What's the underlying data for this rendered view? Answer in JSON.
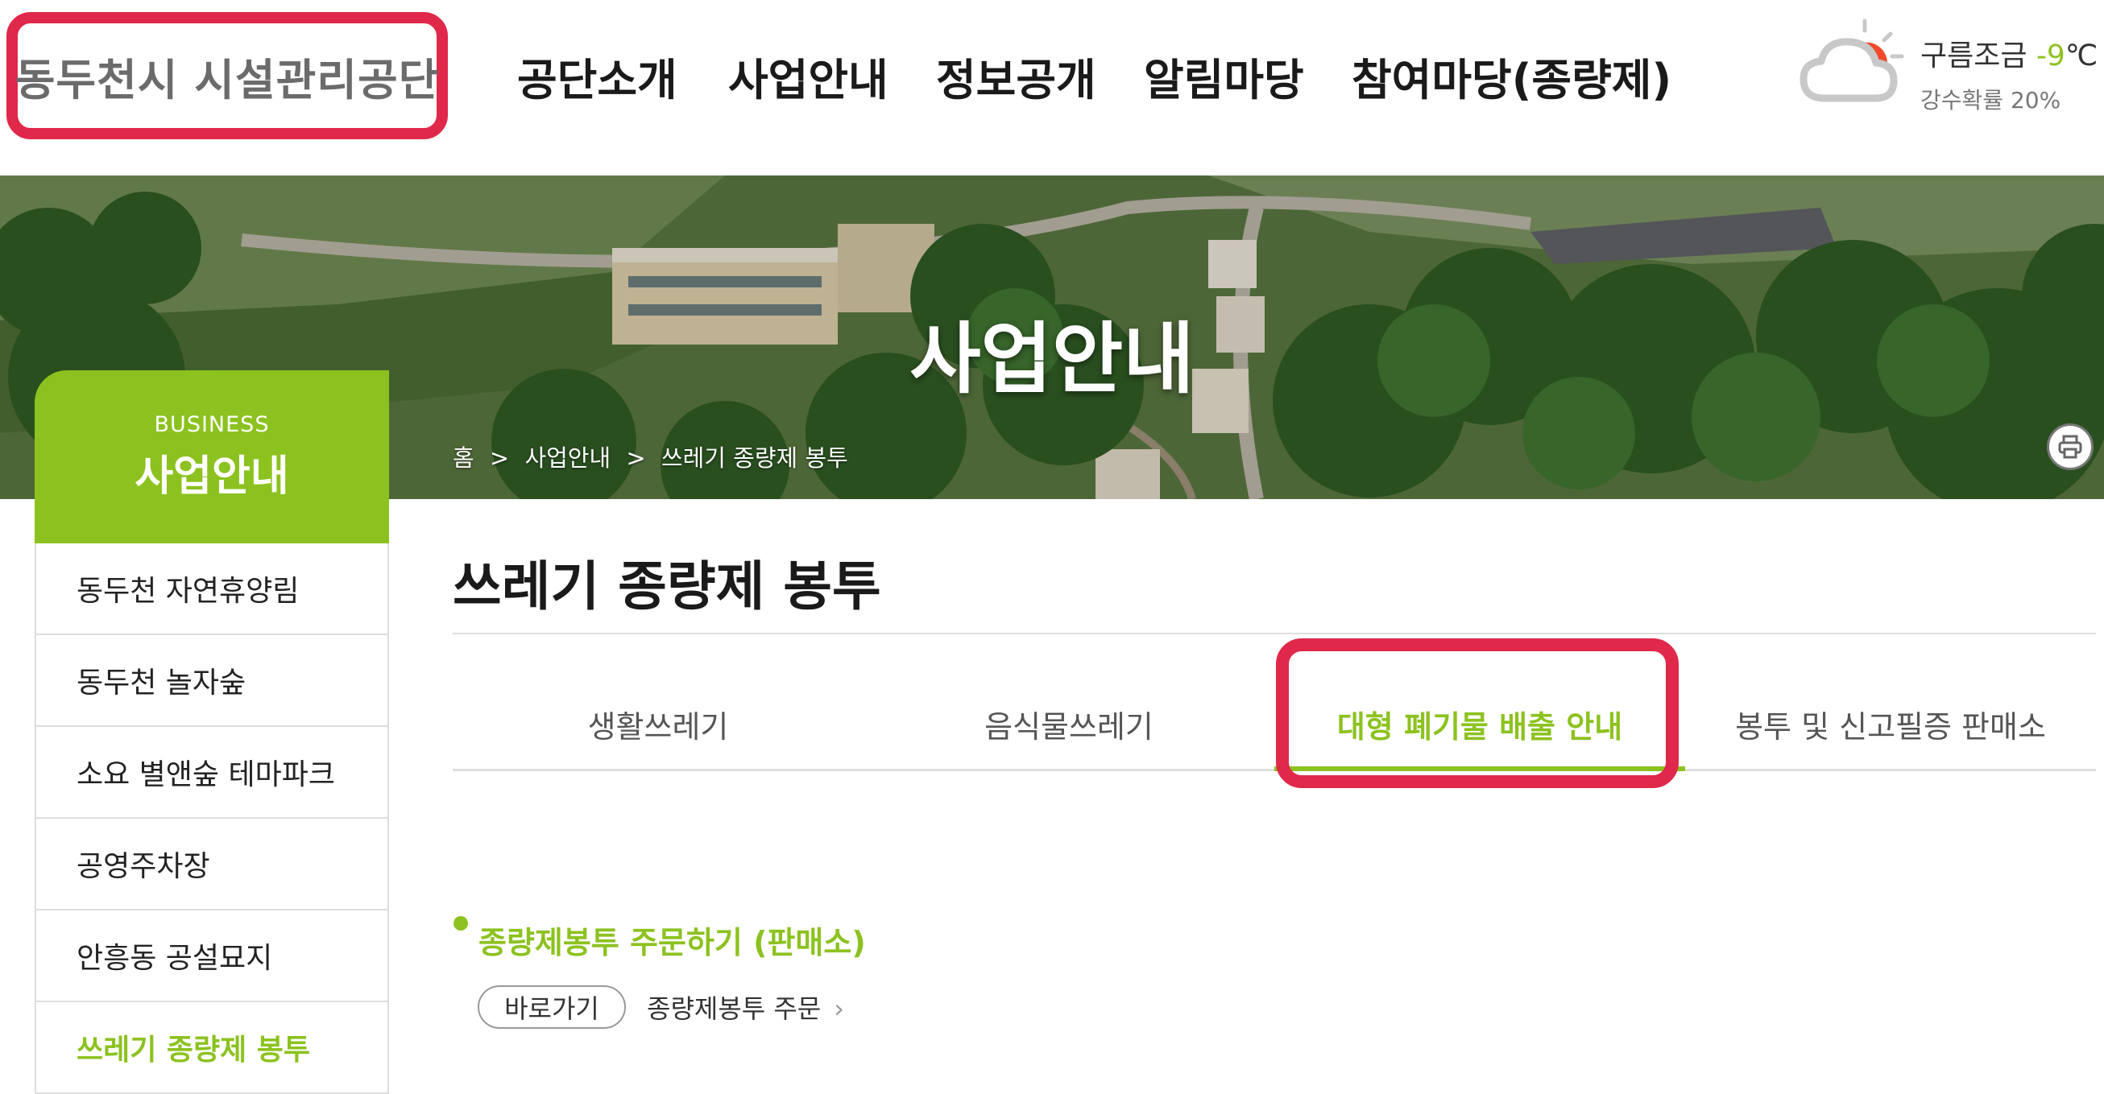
{
  "header": {
    "logo_text": "동두천시 시설관리공단",
    "nav": [
      "공단소개",
      "사업안내",
      "정보공개",
      "알림마당",
      "참여마당(종량제)"
    ]
  },
  "weather": {
    "icon": "cloud-sun-icon",
    "condition": "구름조금",
    "temperature": "-9",
    "unit": "℃",
    "rain_chance": "강수확률 20%"
  },
  "banner": {
    "title": "사업안내",
    "breadcrumb": [
      "홈",
      ">",
      "사업안내",
      ">",
      "쓰레기 종량제 봉투"
    ]
  },
  "sidebar": {
    "eng": "BUSINESS",
    "title": "사업안내",
    "items": [
      "동두천 자연휴양림",
      "동두천 놀자숲",
      "소요 별앤숲 테마파크",
      "공영주차장",
      "안흥동 공설묘지",
      "쓰레기 종량제 봉투"
    ],
    "active_index": 5
  },
  "content": {
    "page_title": "쓰레기 종량제 봉투",
    "tabs": [
      "생활쓰레기",
      "음식물쓰레기",
      "대형 폐기물 배출 안내",
      "봉투 및 신고필증 판매소"
    ],
    "active_tab": 2,
    "section_title": "종량제봉투 주문하기 (판매소)",
    "goto_button": "바로가기",
    "order_link": "종량제봉투 주문"
  },
  "colors": {
    "accent": "#8cc21f",
    "highlight": "#e0284a"
  }
}
